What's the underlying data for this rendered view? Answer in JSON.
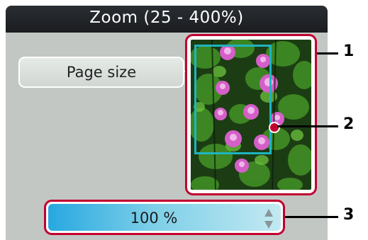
{
  "header": {
    "title": "Zoom (25 - 400%)"
  },
  "controls": {
    "page_size_label": "Page size",
    "zoom_value": "100 %"
  },
  "callouts": [
    {
      "label": "1"
    },
    {
      "label": "2"
    },
    {
      "label": "3"
    }
  ],
  "preview": {
    "description_icon": "flower-photo"
  },
  "colors": {
    "title_bar": "#1f2226",
    "panel": "#c3c7c4",
    "highlight_border": "#c2002f",
    "crop_box": "#1fb4bf",
    "zoom_gradient_start": "#27a8e0",
    "zoom_gradient_end": "#c3e9f1"
  }
}
